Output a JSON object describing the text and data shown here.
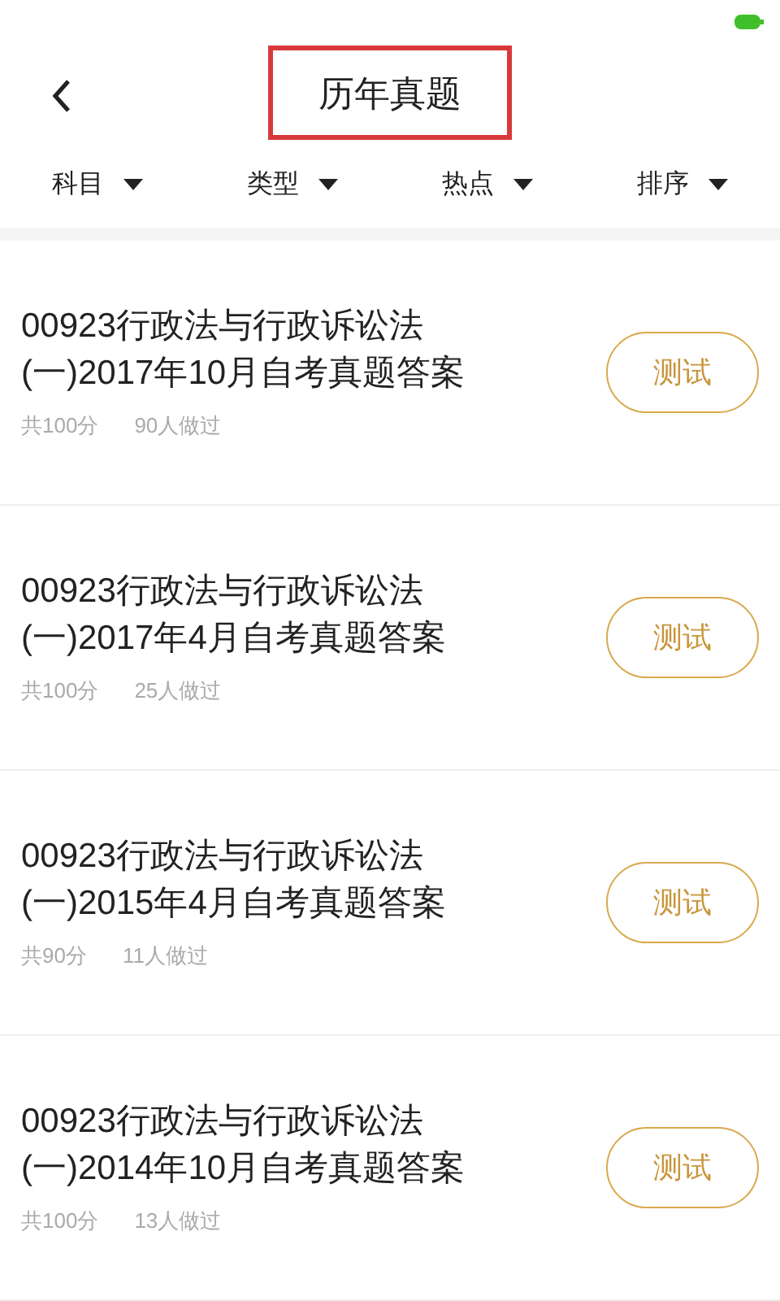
{
  "header": {
    "title": "历年真题"
  },
  "filters": [
    {
      "label": "科目"
    },
    {
      "label": "类型"
    },
    {
      "label": "热点"
    },
    {
      "label": "排序"
    }
  ],
  "items": [
    {
      "title_line1": "00923行政法与行政诉讼法",
      "title_line2": "(一)2017年10月自考真题答案",
      "score": "共100分",
      "count": "90人做过",
      "button": "测试"
    },
    {
      "title_line1": "00923行政法与行政诉讼法",
      "title_line2": "(一)2017年4月自考真题答案",
      "score": "共100分",
      "count": "25人做过",
      "button": "测试"
    },
    {
      "title_line1": "00923行政法与行政诉讼法",
      "title_line2": "(一)2015年4月自考真题答案",
      "score": "共90分",
      "count": "11人做过",
      "button": "测试"
    },
    {
      "title_line1": "00923行政法与行政诉讼法",
      "title_line2": "(一)2014年10月自考真题答案",
      "score": "共100分",
      "count": "13人做过",
      "button": "测试"
    }
  ]
}
